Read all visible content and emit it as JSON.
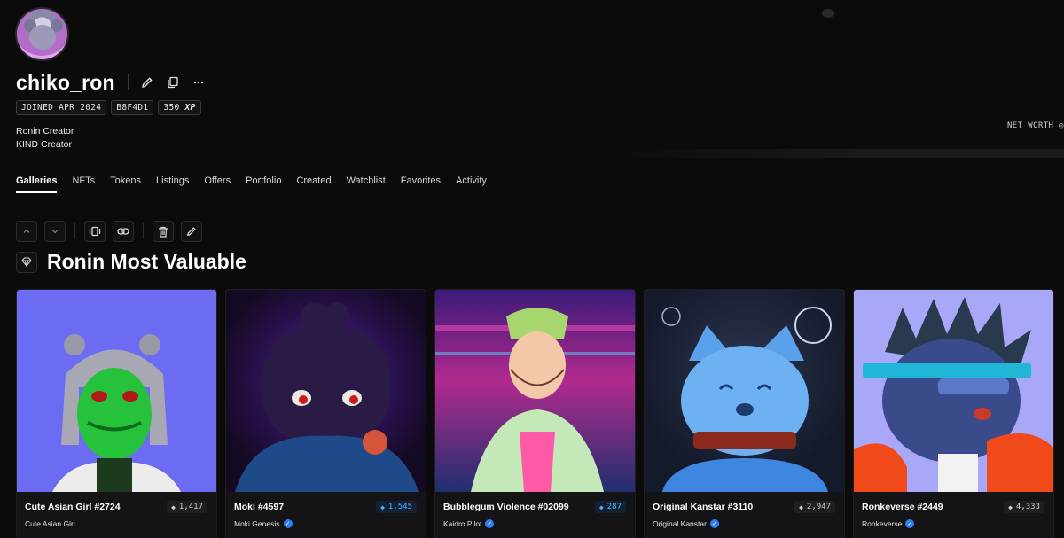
{
  "profile": {
    "username": "chiko_ron",
    "badges": [
      "JOINED APR 2024",
      "B8F4D1",
      "350"
    ],
    "xp_suffix": "XP",
    "roles": [
      "Ronin Creator",
      "KIND Creator"
    ],
    "net_worth_label": "NET WORTH"
  },
  "tabs": [
    {
      "label": "Galleries",
      "active": true
    },
    {
      "label": "NFTs"
    },
    {
      "label": "Tokens"
    },
    {
      "label": "Listings"
    },
    {
      "label": "Offers"
    },
    {
      "label": "Portfolio"
    },
    {
      "label": "Created"
    },
    {
      "label": "Watchlist"
    },
    {
      "label": "Favorites"
    },
    {
      "label": "Activity"
    }
  ],
  "gallery": {
    "title": "Ronin Most Valuable",
    "items": [
      {
        "name": "Cute Asian Girl #2724",
        "collection": "Cute Asian Girl",
        "price": "1,417",
        "verified": false,
        "highlight": false
      },
      {
        "name": "Moki #4597",
        "collection": "Moki Genesis",
        "price": "1,545",
        "verified": true,
        "highlight": true
      },
      {
        "name": "Bubblegum Violence #02099",
        "collection": "Kaidro Pilot",
        "price": "287",
        "verified": true,
        "highlight": true
      },
      {
        "name": "Original Kanstar #3110",
        "collection": "Original Kanstar",
        "price": "2,947",
        "verified": true,
        "highlight": false
      },
      {
        "name": "Ronkeverse #2449",
        "collection": "Ronkeverse",
        "price": "4,333",
        "verified": true,
        "highlight": false
      }
    ]
  },
  "colors": {
    "background": "#0b0b0c",
    "accent_blue": "#4fb0ff",
    "verified": "#2f7ff2",
    "card1_bg": "#6b6cf2",
    "card5_bg": "#a9a7f8"
  }
}
